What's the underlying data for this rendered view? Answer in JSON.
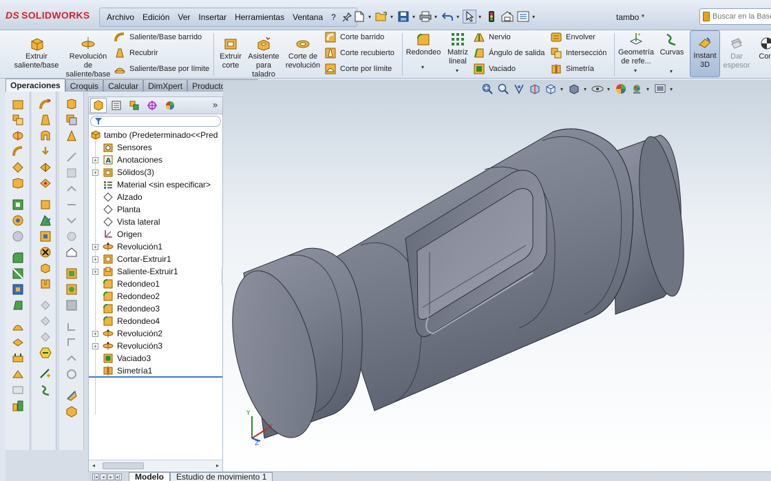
{
  "app": {
    "logo_mark": "DS",
    "logo_text": "SOLIDWORKS",
    "document_title": "tambo *"
  },
  "menu": [
    "Archivo",
    "Edición",
    "Ver",
    "Insertar",
    "Herramientas",
    "Ventana",
    "?"
  ],
  "search": {
    "placeholder": "Buscar en la Base"
  },
  "ribbon": {
    "extrude_boss": "Extruir saliente/base",
    "revolve_boss": "Revolución de saliente/base",
    "swept_boss": "Saliente/Base barrido",
    "lofted_boss": "Recubrir",
    "boundary_boss": "Saliente/Base por límite",
    "extrude_cut": "Extruir corte",
    "hole_wizard": "Asistente para taladro",
    "revolve_cut": "Corte de revolución",
    "swept_cut": "Corte barrido",
    "lofted_cut": "Corte recubierto",
    "boundary_cut": "Corte por límite",
    "fillet": "Redondeo",
    "linear_pattern": "Matriz lineal",
    "rib": "Nervio",
    "draft": "Ángulo de salida",
    "shell": "Vaciado",
    "wrap": "Envolver",
    "intersect": "Intersección",
    "mirror": "Simetría",
    "ref_geometry": "Geometría de refe...",
    "curves": "Curvas",
    "instant3d": "Instant 3D",
    "thicken": "Dar espesor",
    "com": "Com"
  },
  "tabs": [
    "Operaciones",
    "Croquis",
    "Calcular",
    "DimXpert",
    "Productos Office"
  ],
  "feature_tree": {
    "root": "tambo  (Predeterminado<<Pred",
    "items": [
      {
        "label": "Sensores",
        "icon": "sensor-icon",
        "expandable": false
      },
      {
        "label": "Anotaciones",
        "icon": "annotation-icon",
        "expandable": true
      },
      {
        "label": "Sólidos(3)",
        "icon": "solid-bodies-icon",
        "expandable": true
      },
      {
        "label": "Material <sin especificar>",
        "icon": "material-icon",
        "expandable": false
      },
      {
        "label": "Alzado",
        "icon": "plane-icon",
        "expandable": false
      },
      {
        "label": "Planta",
        "icon": "plane-icon",
        "expandable": false
      },
      {
        "label": "Vista lateral",
        "icon": "plane-icon",
        "expandable": false
      },
      {
        "label": "Origen",
        "icon": "origin-icon",
        "expandable": false
      },
      {
        "label": "Revolución1",
        "icon": "revolve-icon",
        "expandable": true
      },
      {
        "label": "Cortar-Extruir1",
        "icon": "cut-extrude-icon",
        "expandable": true
      },
      {
        "label": "Saliente-Extruir1",
        "icon": "boss-extrude-icon",
        "expandable": true
      },
      {
        "label": "Redondeo1",
        "icon": "fillet-icon",
        "expandable": false
      },
      {
        "label": "Redondeo2",
        "icon": "fillet-icon",
        "expandable": false
      },
      {
        "label": "Redondeo3",
        "icon": "fillet-icon",
        "expandable": false
      },
      {
        "label": "Redondeo4",
        "icon": "fillet-icon",
        "expandable": false
      },
      {
        "label": "Revolución2",
        "icon": "revolve-icon",
        "expandable": true
      },
      {
        "label": "Revolución3",
        "icon": "revolve-icon",
        "expandable": true
      },
      {
        "label": "Vaciado3",
        "icon": "shell-icon",
        "expandable": false
      },
      {
        "label": "Simetría1",
        "icon": "mirror-icon",
        "expandable": false
      }
    ]
  },
  "bottom_tabs": [
    "Modelo",
    "Estudio de movimiento 1"
  ],
  "triad": {
    "x": "X",
    "y": "Y",
    "z": "Z"
  },
  "colors": {
    "brand": "#d8222a",
    "part_gray": "#7d8290",
    "highlight": "#3d7bd8"
  }
}
